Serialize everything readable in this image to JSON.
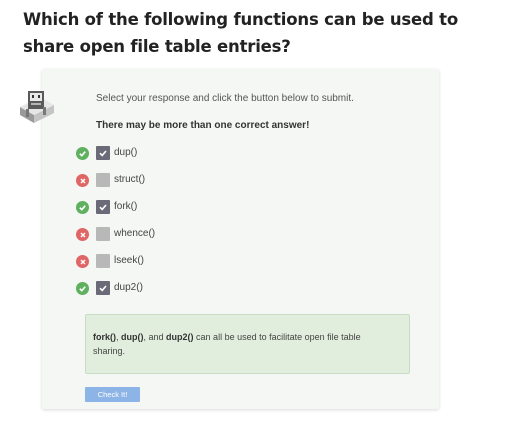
{
  "question": "Which of the following functions can be used to share open file table entries?",
  "instruction": "Select your response and click the button below to submit.",
  "note": "There may be more than one correct answer!",
  "options": [
    {
      "label": "dup()",
      "checked": true,
      "correct": true
    },
    {
      "label": "struct()",
      "checked": false,
      "correct": false
    },
    {
      "label": "fork()",
      "checked": true,
      "correct": true
    },
    {
      "label": "whence()",
      "checked": false,
      "correct": false
    },
    {
      "label": "lseek()",
      "checked": false,
      "correct": false
    },
    {
      "label": "dup2()",
      "checked": true,
      "correct": true
    }
  ],
  "explanation": {
    "fn1": "fork()",
    "sep1": ", ",
    "fn2": "dup()",
    "sep2": ", and ",
    "fn3": "dup2()",
    "rest": " can all be used to facilitate open file table sharing."
  },
  "button_label": "Check It!",
  "colors": {
    "correct": "#5fb05f",
    "wrong": "#e06666",
    "checked_box": "#6a6a78",
    "button": "#8db4e6"
  }
}
